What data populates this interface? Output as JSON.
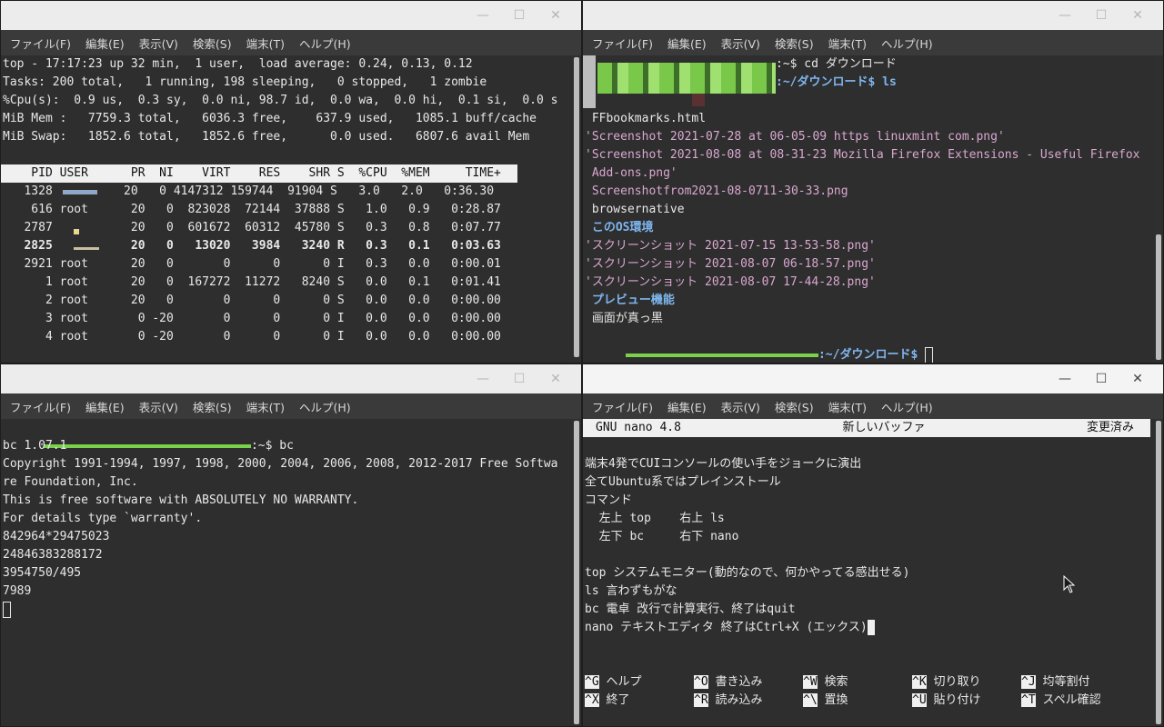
{
  "menu": [
    "ファイル(F)",
    "編集(E)",
    "表示(V)",
    "検索(S)",
    "端末(T)",
    "ヘルプ(H)"
  ],
  "window_controls": {
    "minimize": "—",
    "maximize": "☐",
    "close": "✕"
  },
  "top": {
    "lines": [
      "top - 17:17:23 up 32 min,  1 user,  load average: 0.24, 0.13, 0.12",
      "Tasks: 200 total,   1 running, 198 sleeping,   0 stopped,   1 zombie",
      "%Cpu(s):  0.9 us,  0.3 sy,  0.0 ni, 98.7 id,  0.0 wa,  0.0 hi,  0.1 si,  0.0 s",
      "MiB Mem :   7759.3 total,   6036.3 free,    637.9 used,   1085.1 buff/cache",
      "MiB Swap:   1852.6 total,   1852.6 free,      0.0 used.   6807.6 avail Mem"
    ],
    "header": "    PID USER      PR  NI    VIRT    RES    SHR S  %CPU  %MEM     TIME+",
    "rows": [
      "   1328          20   0 4147312 159744  91904 S   3.0   2.0   0:36.30",
      "    616 root      20   0  823028  72144  37888 S   1.0   0.9   0:28.87",
      "   2787           20   0  601672  60312  45780 S   0.3   0.8   0:07.77",
      "   2825           20   0   13020   3984   3240 R   0.3   0.1   0:03.63",
      "   2921 root      20   0       0      0      0 I   0.3   0.0   0:00.01",
      "      1 root      20   0  167272  11272   8240 S   0.0   0.1   0:01.41",
      "      2 root      20   0       0      0      0 S   0.0   0.0   0:00.00",
      "      3 root       0 -20       0      0      0 I   0.0   0.0   0:00.00",
      "      4 root       0 -20       0      0      0 I   0.0   0.0   0:00.00"
    ]
  },
  "ls": {
    "prompt1": ":~$ cd ダウンロード",
    "prompt2": ":~/ダウンロード$ ls",
    "f1": " FFbookmarks.html",
    "f2": "'Screenshot 2021-07-28 at 06-05-09 https linuxmint com.png'",
    "f3": "'Screenshot 2021-08-08 at 08-31-23 Mozilla Firefox Extensions - Useful Firefox",
    "f3b": " Add-ons.png'",
    "f4": " Screenshotfrom2021-08-0711-30-33.png",
    "f5": " browsernative",
    "f6": " このOS環境",
    "f7": "'スクリーンショット 2021-07-15 13-53-58.png'",
    "f8": "'スクリーンショット 2021-08-07 06-18-57.png'",
    "f9": "'スクリーンショット 2021-08-07 17-44-28.png'",
    "f10": " プレビュー機能",
    "f11": " 画面が真っ黒",
    "prompt3": ":~/ダウンロード$ "
  },
  "bc": {
    "prompt": ":~$ bc",
    "lines": [
      "bc 1.07.1",
      "Copyright 1991-1994, 1997, 1998, 2000, 2004, 2006, 2008, 2012-2017 Free Softwa",
      "re Foundation, Inc.",
      "This is free software with ABSOLUTELY NO WARRANTY.",
      "For details type `warranty'.",
      "842964*29475023",
      "24846383288172",
      "3954750/495",
      "7989"
    ]
  },
  "nano": {
    "version": "GNU nano 4.8",
    "buffer": "新しいバッファ",
    "modified": "変更済み",
    "lines": [
      "",
      "端末4発でCUIコンソールの使い手をジョークに演出",
      "全てUbuntu系ではプレインストール",
      "コマンド",
      "  左上 top    右上 ls",
      "  左下 bc     右下 nano",
      "",
      "top システムモニター(動的なので、何かやってる感出せる)",
      "ls 言わずもがな",
      "bc 電卓 改行で計算実行、終了はquit",
      "nano テキストエディタ 終了はCtrl+X (エックス)"
    ],
    "shortcuts_row1": [
      {
        "key": "^G",
        "label": " ヘルプ"
      },
      {
        "key": "^O",
        "label": " 書き込み"
      },
      {
        "key": "^W",
        "label": " 検索"
      },
      {
        "key": "^K",
        "label": " 切り取り"
      },
      {
        "key": "^J",
        "label": " 均等割付"
      }
    ],
    "shortcuts_row2": [
      {
        "key": "^X",
        "label": " 終了"
      },
      {
        "key": "^R",
        "label": " 読み込み"
      },
      {
        "key": "^\\",
        "label": " 置換"
      },
      {
        "key": "^U",
        "label": " 貼り付け"
      },
      {
        "key": "^T",
        "label": " スペル確認"
      }
    ]
  }
}
